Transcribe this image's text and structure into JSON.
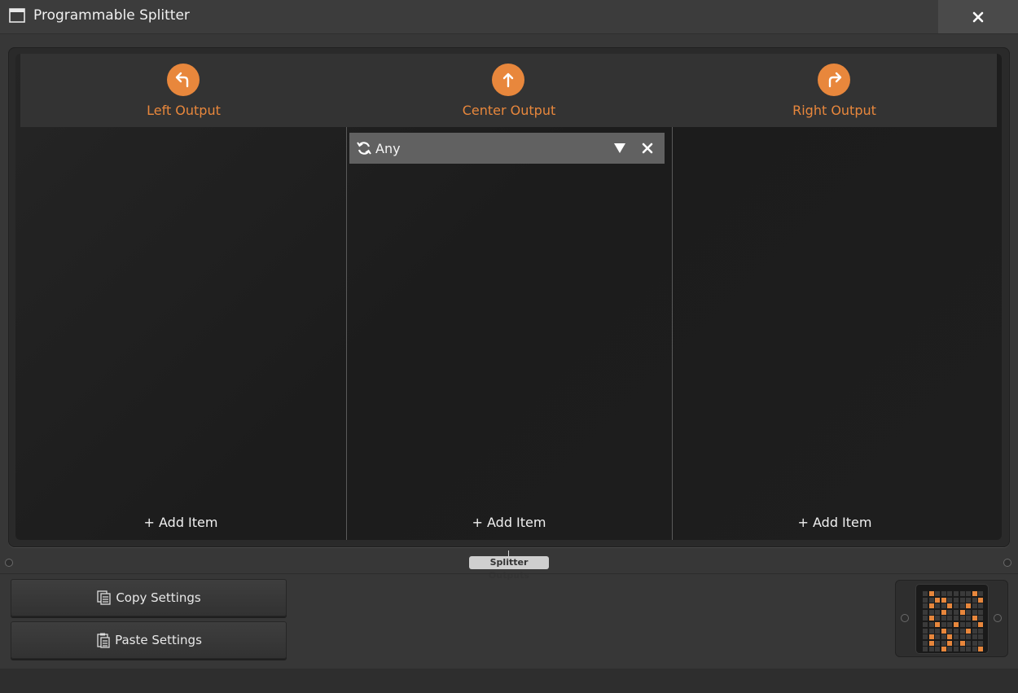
{
  "window": {
    "title": "Programmable Splitter",
    "close_icon": "close-icon"
  },
  "columns": [
    {
      "title": "Left Output",
      "icon": "turn-left-arrow-icon",
      "add_label": "+ Add Item"
    },
    {
      "title": "Center Output",
      "icon": "up-arrow-icon",
      "add_label": "+ Add Item"
    },
    {
      "title": "Right Output",
      "icon": "turn-right-arrow-icon",
      "add_label": "+ Add Item"
    }
  ],
  "center_filter": {
    "label": "Any",
    "icon": "cycle-arrows-icon",
    "dropdown_icon": "triangle-down-icon",
    "remove_icon": "close-icon"
  },
  "section_tag": "Splitter Outputs",
  "buttons": {
    "copy": "Copy Settings",
    "paste": "Paste Settings"
  },
  "colors": {
    "accent": "#e8873c",
    "panel": "#1f1f1f",
    "header": "#333333",
    "filter_row": "#616161"
  }
}
